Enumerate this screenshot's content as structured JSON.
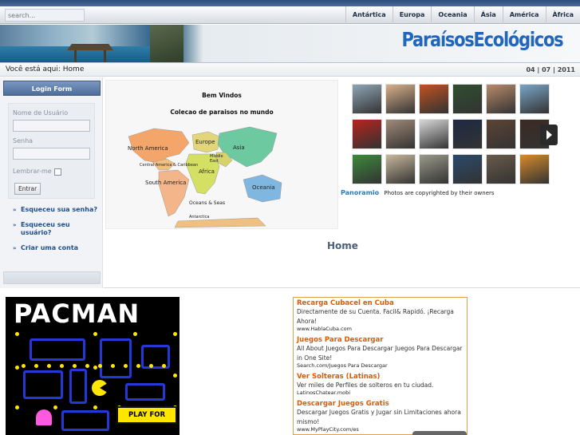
{
  "search": {
    "placeholder": "search..."
  },
  "nav": {
    "items": [
      "Antártica",
      "Europa",
      "Oceania",
      "Ásia",
      "América",
      "Àfrica"
    ]
  },
  "site": {
    "title": "ParaísosEcológicos"
  },
  "breadcrumb": {
    "prefix": "Você está aqui:",
    "current": "Home"
  },
  "date": "04 | 07 | 2011",
  "login": {
    "heading": "Login Form",
    "username_label": "Nome de Usuário",
    "password_label": "Senha",
    "remember_label": "Lembrar-me",
    "submit_label": "Entrar",
    "links": [
      "Esqueceu sua senha?",
      "Esqueceu seu usuário?",
      "Criar uma conta"
    ]
  },
  "welcome": {
    "title": "Bem Vindos",
    "subtitle": "Colecao de paraisos no mundo"
  },
  "map": {
    "labels": [
      "North America",
      "Central America & Caribbean",
      "South America",
      "Europe",
      "Asia",
      "Middle East",
      "Africa",
      "Oceania",
      "Oceans & Seas",
      "Antarctica"
    ],
    "colors": {
      "north_america": "#f4a66a",
      "central_america": "#f0c080",
      "south_america": "#f5b58a",
      "europe": "#e3d67a",
      "asia": "#6cc9a0",
      "middle_east": "#d6d26c",
      "africa": "#d3e064",
      "oceania": "#7fb7e0",
      "antarctica": "#f0c080"
    }
  },
  "panoramio": {
    "brand": "Panoramio",
    "caption": "Photos are copyrighted by their owners"
  },
  "home": {
    "title": "Home"
  },
  "ad_game": {
    "title": "PACMAN",
    "cta": "PLAY FOR FREE"
  },
  "ads": [
    {
      "title": "Recarga Cubacel en Cuba",
      "desc": "Directamente de su Cuenta. Facil& Rapidó. ¡Recarga Ahora!",
      "url": "www.HablaCuba.com"
    },
    {
      "title": "Juegos Para Descargar",
      "desc": "All About Juegos Para Descargar Juegos Para Descargar in One Site!",
      "url": "Search.com/Juegos Para Descargar"
    },
    {
      "title": "Ver Solteras (Latinas)",
      "desc": "Ver miles de Perfiles de solteros en tu ciudad.",
      "url": "LatinosChatear.mobi"
    },
    {
      "title": "Descargar Juegos Gratis",
      "desc": "Descargar Juegos Gratis y Jugar sin Limitaciones ahora mismo!",
      "url": "www.MyPlayCity.com/es"
    }
  ],
  "thumb_colors": [
    [
      "#8fa6b6",
      "#d8b08a",
      "#c1521f",
      "#2f4f2f",
      "#b88a6a",
      "#7aa6c8"
    ],
    [
      "#b8231c",
      "#a08a78",
      "#d8d8d8",
      "#1c2a44",
      "#5c4434",
      "#3a2a22"
    ],
    [
      "#3c8a3c",
      "#c8b89a",
      "#9a9a8a",
      "#2a4a6a",
      "#6a5a4a",
      "#d88a2a"
    ]
  ]
}
